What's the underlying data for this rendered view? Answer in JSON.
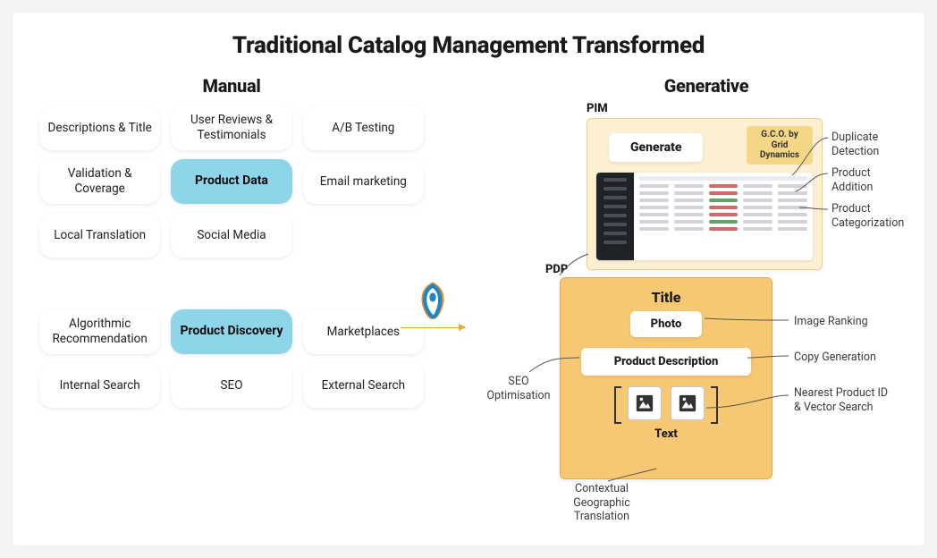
{
  "title": "Traditional Catalog Management Transformed",
  "left": {
    "heading": "Manual",
    "group1": {
      "r0c0": "Descriptions & Title",
      "r0c1": "User Reviews & Testimonials",
      "r0c2": "A/B Testing",
      "r1c0": "Validation & Coverage",
      "r1c1": "Product Data",
      "r1c2": "Email marketing",
      "r2c0": "Local Translation",
      "r2c1": "Social Media"
    },
    "group2": {
      "r0c0": "Algorithmic Recommendation",
      "r0c1": "Product Discovery",
      "r0c2": "Marketplaces",
      "r1c0": "Internal Search",
      "r1c1": "SEO",
      "r1c2": "External Search"
    }
  },
  "right": {
    "heading": "Generative",
    "pim_label": "PIM",
    "pdp_label": "PDP",
    "gco": "G.C.O. by Grid Dynamics",
    "generate": "Generate",
    "pdp_title": "Title",
    "photo": "Photo",
    "product_description": "Product Description",
    "text": "Text"
  },
  "annotations": {
    "duplicate_detection": "Duplicate Detection",
    "product_addition": "Product Addition",
    "product_categorization": "Product Categorization",
    "image_ranking": "Image Ranking",
    "copy_generation": "Copy Generation",
    "nearest_product": "Nearest Product ID & Vector Search",
    "seo_optimisation": "SEO Optimisation",
    "contextual_translation": "Contextual Geographic Translation"
  }
}
